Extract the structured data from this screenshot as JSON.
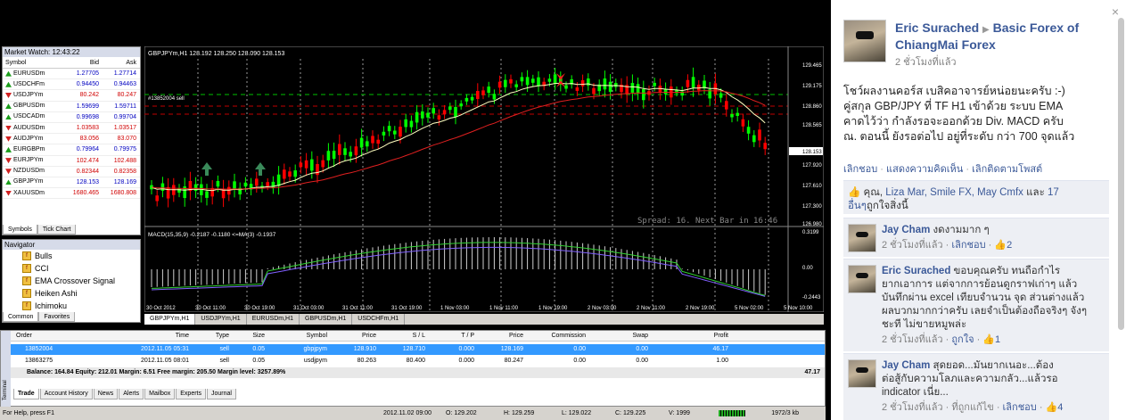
{
  "market_watch": {
    "title": "Market Watch: 12:43:22",
    "columns": [
      "Symbol",
      "Bid",
      "Ask"
    ],
    "rows": [
      {
        "symbol": "EURUSDm",
        "bid": "1.27705",
        "ask": "1.27714",
        "dir": "up"
      },
      {
        "symbol": "USDCHFm",
        "bid": "0.94450",
        "ask": "0.94463",
        "dir": "up"
      },
      {
        "symbol": "USDJPYm",
        "bid": "80.242",
        "ask": "80.247",
        "dir": "down"
      },
      {
        "symbol": "GBPUSDm",
        "bid": "1.59699",
        "ask": "1.59711",
        "dir": "up"
      },
      {
        "symbol": "USDCADm",
        "bid": "0.99698",
        "ask": "0.99704",
        "dir": "up"
      },
      {
        "symbol": "AUDUSDm",
        "bid": "1.03583",
        "ask": "1.03517",
        "dir": "down"
      },
      {
        "symbol": "AUDJPYm",
        "bid": "83.056",
        "ask": "83.070",
        "dir": "down"
      },
      {
        "symbol": "EURGBPm",
        "bid": "0.79964",
        "ask": "0.79975",
        "dir": "up"
      },
      {
        "symbol": "EURJPYm",
        "bid": "102.474",
        "ask": "102.488",
        "dir": "down"
      },
      {
        "symbol": "NZDUSDm",
        "bid": "0.82344",
        "ask": "0.82358",
        "dir": "down"
      },
      {
        "symbol": "GBPJPYm",
        "bid": "128.153",
        "ask": "128.169",
        "dir": "up"
      },
      {
        "symbol": "XAUUSDm",
        "bid": "1680.465",
        "ask": "1680.808",
        "dir": "down"
      }
    ],
    "tabs": [
      "Symbols",
      "Tick Chart"
    ]
  },
  "navigator": {
    "title": "Navigator",
    "items": [
      "Bulls",
      "CCI",
      "EMA Crossover Signal",
      "Heiken Ashi",
      "Ichimoku"
    ],
    "tabs": [
      "Common",
      "Favorites"
    ]
  },
  "chart": {
    "header": "GBPJPYm,H1  128.192 128.250 128.090 128.153",
    "order_label": "#13852004 sell",
    "spread_text": "Spread: 16. Next Bar in 16:46",
    "macd_header": "MACD(15,35,9) -0.2187 -0.1180  <=MA(3) -0.1937",
    "price_ticks": [
      "129.465",
      "129.175",
      "128.860",
      "128.565",
      "128.153",
      "127.920",
      "127.610",
      "127.300",
      "126.980"
    ],
    "macd_ticks": [
      "0.3199",
      "0.00",
      "-0.2443"
    ],
    "time_ticks": [
      "30 Oct 2012",
      "30 Oct 11:00",
      "30 Oct 19:00",
      "31 Oct 03:00",
      "31 Oct 11:00",
      "31 Oct 19:00",
      "1 Nov 03:00",
      "1 Nov 11:00",
      "1 Nov 19:00",
      "2 Nov 03:00",
      "2 Nov 11:00",
      "2 Nov 19:00",
      "5 Nov 02:00",
      "5 Nov 10:00"
    ],
    "colors": {
      "bull": "#00ff00",
      "bear": "#ff0000",
      "ema_fast": "#ffffc0",
      "ema_slow": "#e02020"
    }
  },
  "chart_tabs": [
    "GBPJPYm,H1",
    "USDJPYm,H1",
    "EURUSDm,H1",
    "GBPUSDm,H1",
    "USDCHFm,H1"
  ],
  "terminal": {
    "columns": [
      "Order",
      "Time",
      "Type",
      "Size",
      "Symbol",
      "Price",
      "S / L",
      "T / P",
      "Price",
      "Commission",
      "Swap",
      "Profit"
    ],
    "rows": [
      [
        "13852004",
        "2012.11.05 05:31",
        "sell",
        "0.05",
        "gbpjpym",
        "128.910",
        "128.710",
        "0.000",
        "128.169",
        "0.00",
        "0.00",
        "46.17"
      ],
      [
        "13863275",
        "2012.11.05 08:01",
        "sell",
        "0.05",
        "usdjpym",
        "80.263",
        "80.400",
        "0.000",
        "80.247",
        "0.00",
        "0.00",
        "1.00"
      ]
    ],
    "balance": "Balance: 164.84  Equity: 212.01  Margin: 6.51  Free margin: 205.50  Margin level: 3257.89%",
    "balance_profit": "47.17",
    "side_label": "Terminal",
    "tabs": [
      "Trade",
      "Account History",
      "News",
      "Alerts",
      "Mailbox",
      "Experts",
      "Journal"
    ]
  },
  "status_bar": {
    "help": "For Help, press F1",
    "date": "2012.11.02 09:00",
    "open": "O: 129.202",
    "high": "H: 129.259",
    "low": "L: 129.022",
    "close": "C: 129.225",
    "volume": "V: 1999",
    "traffic": "1972/3 kb"
  },
  "facebook": {
    "author": "Eric Surached",
    "group": "Basic Forex of ChiangMai Forex",
    "time": "2 ชั่วโมงที่แล้ว",
    "post_lines": [
      "โชว์ผลงานคอร์ส เบสิคอาจารย์หน่อยนะครับ :-)",
      "คู่สกุล GBP/JPY ที่ TF H1 เข้าด้วย ระบบ EMA",
      "คาดไว้ว่า กำลังรอจะออกด้วย Div. MACD ครับ",
      "ณ. ตอนนี้ ยังรอต่อไป อยู่ที่ระดับ กว่า 700 จุดแล้ว"
    ],
    "actions": {
      "like": "เลิกชอบ",
      "comment": "แสดงความคิดเห็น",
      "unfollow": "เลิกติดตามโพสต์"
    },
    "likes": {
      "you": "คุณ,",
      "names": "Liza Mar, Smile FX, May Cmfx",
      "and": "และ",
      "others": "17 อื่นๆ",
      "suffix": "ถูกใจสิ่งนี้"
    },
    "comments": [
      {
        "name": "Jay Cham",
        "lines": [
          "งดงามมาก ๆ"
        ],
        "time": "2 ชั่วโมงที่แล้ว",
        "action": "เลิกชอบ",
        "likes": "2"
      },
      {
        "name": "Eric Surached",
        "lines": [
          "ขอบคุณครับ ทนถือกำไร",
          "ยากเอาการ แต่จากการย้อนดูกราฟเก่าๆ แล้ว",
          "บันทึกผ่าน excel เทียบจำนวน จุด ส่วนต่างแล้ว",
          "ผลบวกมากกว่าครับ เลยจำเป็นต้องถือจริงๆ จังๆ",
          "ชะที ไม่ขายหมูพล่ะ"
        ],
        "time": "2 ชั่วโมงที่แล้ว",
        "action": "ถูกใจ",
        "likes": "1"
      },
      {
        "name": "Jay Cham",
        "lines": [
          "สุดยอด...มันยากเนอะ...ต้อง",
          "ต่อสู้กับความโลภและความกลัว...แล้วรอ",
          "indicator เนี่ย..."
        ],
        "time": "2 ชั่วโมงที่แล้ว",
        "extra": "ที่ถูกแก้ไข",
        "action": "เลิกชอบ",
        "likes": "4"
      }
    ]
  }
}
